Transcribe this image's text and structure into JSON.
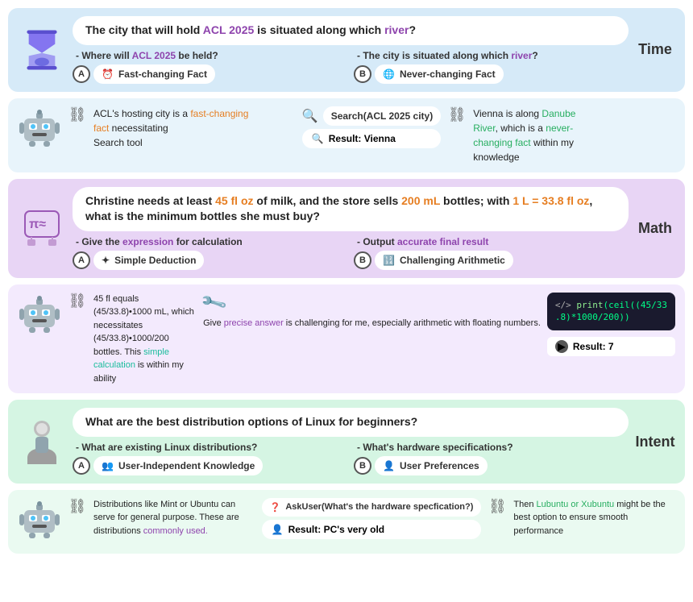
{
  "sections": [
    {
      "id": "time",
      "label": "Time",
      "bg": "#d6eaf8",
      "question": "The city that will hold ACL 2025 is situated along which river?",
      "question_parts": [
        {
          "text": "ACL 2025",
          "color": "purple"
        },
        {
          "text": "river",
          "color": "purple"
        }
      ],
      "subA_text": "- Where will ACL 2025 be held?",
      "subA_badge": "Fast-changing Fact",
      "subA_icon": "⏰",
      "subB_text": "- The city is situated along which river?",
      "subB_badge": "Never-changing Fact",
      "subB_icon": "🌎"
    },
    {
      "id": "math",
      "label": "Math",
      "bg": "#e8d5f5",
      "question": "Christine needs at least 45 fl oz of milk, and the store sells 200 mL bottles; with 1 L = 33.8 fl oz, what is the minimum bottles she must buy?",
      "subA_text": "- Give the expression for calculation",
      "subA_badge": "Simple Deduction",
      "subA_icon": "✦",
      "subB_text": "- Output accurate final result",
      "subB_badge": "Challenging Arithmetic",
      "subB_icon": "🔢"
    },
    {
      "id": "intent",
      "label": "Intent",
      "bg": "#d5f5e3",
      "question": "What are the best distribution options of Linux for beginners?",
      "subA_text": "- What are existing Linux distributions?",
      "subA_badge": "User-Independent Knowledge",
      "subA_icon": "👥",
      "subB_text": "- What's hardware specifications?",
      "subB_badge": "User Preferences",
      "subB_icon": "👤"
    }
  ],
  "bottom_sections": [
    {
      "id": "time-bottom",
      "bg": "#e8f4fb",
      "left_text": "ACL's hosting city is a fast-changing fact necessitating Search tool",
      "left_highlights": [
        "fast-changing",
        "fact"
      ],
      "tool_label": "Search(ACL 2025 city)",
      "tool_result": "Result: Vienna",
      "right_text": "Vienna is along Danube River, which is a never-changing fact within my knowledge",
      "right_highlights": [
        "Danube River",
        "never-changing fact"
      ]
    },
    {
      "id": "math-bottom",
      "bg": "#f3eafd",
      "left_text": "45 fl equals (45/33.8)•1000 mL, which necessitates (45/33.8)•1000/200 bottles. This simple calculation is within my ability",
      "left_highlights": [
        "simple calculation"
      ],
      "middle_text": "Give precise answer is challenging for me, especially arithmetic with floating numbers.",
      "middle_highlights": [
        "precise answer"
      ],
      "code": "print(ceil((45/33\n.8)*1000/200))",
      "code_result": "Result: 7"
    },
    {
      "id": "intent-bottom",
      "bg": "#eafaf1",
      "left_text": "Distributions like Mint or Ubuntu can serve for general purpose. These are distributions commonly used.",
      "left_highlights": [
        "commonly used"
      ],
      "tool_label": "AskUser(What's the hardware specfication?)",
      "tool_result": "Result: PC's very old",
      "right_text": "Then Lubuntu or Xubuntu might be the best option to ensure smooth performance",
      "right_highlights": [
        "Lubuntu or Xubuntu"
      ]
    }
  ]
}
